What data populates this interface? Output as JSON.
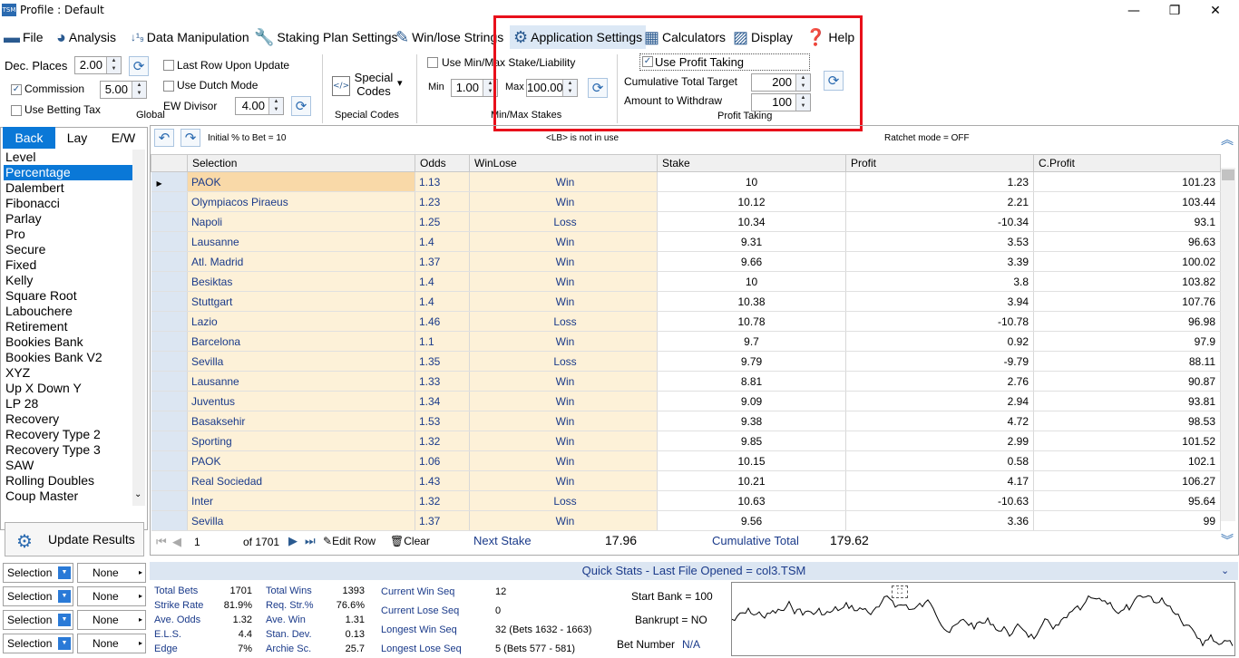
{
  "window": {
    "title": "Profile : Default",
    "app_badge": "TSM"
  },
  "menu": [
    "File",
    "Analysis",
    "Data Manipulation",
    "Staking Plan Settings",
    "Win/lose Strings",
    "Application Settings",
    "Calculators",
    "Display",
    "Help"
  ],
  "global": {
    "dec_places_label": "Dec. Places",
    "dec_places_value": "2.00",
    "commission_label": "Commission",
    "commission_value": "5.00",
    "use_betting_tax": "Use Betting Tax",
    "last_row": "Last Row Upon Update",
    "dutch": "Use Dutch Mode",
    "ew_divisor_label": "EW Divisor",
    "ew_divisor_value": "4.00",
    "group_label": "Global"
  },
  "special": {
    "label": "Special Codes",
    "group": "Special Codes"
  },
  "minmax": {
    "checkbox": "Use Min/Max Stake/Liability",
    "min_label": "Min",
    "min_value": "1.00",
    "max_label": "Max",
    "max_value": "100.00",
    "group": "Min/Max Stakes"
  },
  "profit": {
    "checkbox": "Use Profit Taking",
    "target_label": "Cumulative Total Target",
    "target_value": "200",
    "withdraw_label": "Amount to Withdraw",
    "withdraw_value": "100",
    "group": "Profit Taking"
  },
  "tabs": [
    "Back",
    "Lay",
    "E/W"
  ],
  "strategies": [
    "Level",
    "Percentage",
    "Dalembert",
    "Fibonacci",
    "Parlay",
    "Pro",
    "Secure",
    "Fixed",
    "Kelly",
    "Square Root",
    "Labouchere",
    "Retirement",
    "Bookies Bank",
    "Bookies Bank V2",
    "XYZ",
    "Up X Down Y",
    "LP 28",
    "Recovery",
    "Recovery Type 2",
    "Recovery Type 3",
    "SAW",
    "Rolling Doubles",
    "Coup Master"
  ],
  "selected_strategy": "Percentage",
  "update_button": "Update Results",
  "selectors": [
    {
      "label": "Selection",
      "value": "None"
    },
    {
      "label": "Selection",
      "value": "None"
    },
    {
      "label": "Selection",
      "value": "None"
    },
    {
      "label": "Selection",
      "value": "None"
    }
  ],
  "grid_info": {
    "initial": "Initial % to Bet = 10",
    "lb": "<LB> is not in use",
    "ratchet": "Ratchet mode = OFF"
  },
  "columns": [
    "Selection",
    "Odds",
    "WinLose",
    "Stake",
    "Profit",
    "C.Profit"
  ],
  "rows": [
    [
      "PAOK",
      "1.13",
      "Win",
      "10",
      "1.23",
      "101.23"
    ],
    [
      "Olympiacos Piraeus",
      "1.23",
      "Win",
      "10.12",
      "2.21",
      "103.44"
    ],
    [
      "Napoli",
      "1.25",
      "Loss",
      "10.34",
      "-10.34",
      "93.1"
    ],
    [
      "Lausanne",
      "1.4",
      "Win",
      "9.31",
      "3.53",
      "96.63"
    ],
    [
      "Atl. Madrid",
      "1.37",
      "Win",
      "9.66",
      "3.39",
      "100.02"
    ],
    [
      "Besiktas",
      "1.4",
      "Win",
      "10",
      "3.8",
      "103.82"
    ],
    [
      "Stuttgart",
      "1.4",
      "Win",
      "10.38",
      "3.94",
      "107.76"
    ],
    [
      "Lazio",
      "1.46",
      "Loss",
      "10.78",
      "-10.78",
      "96.98"
    ],
    [
      "Barcelona",
      "1.1",
      "Win",
      "9.7",
      "0.92",
      "97.9"
    ],
    [
      "Sevilla",
      "1.35",
      "Loss",
      "9.79",
      "-9.79",
      "88.11"
    ],
    [
      "Lausanne",
      "1.33",
      "Win",
      "8.81",
      "2.76",
      "90.87"
    ],
    [
      "Juventus",
      "1.34",
      "Win",
      "9.09",
      "2.94",
      "93.81"
    ],
    [
      "Basaksehir",
      "1.53",
      "Win",
      "9.38",
      "4.72",
      "98.53"
    ],
    [
      "Sporting",
      "1.32",
      "Win",
      "9.85",
      "2.99",
      "101.52"
    ],
    [
      "PAOK",
      "1.06",
      "Win",
      "10.15",
      "0.58",
      "102.1"
    ],
    [
      "Real Sociedad",
      "1.43",
      "Win",
      "10.21",
      "4.17",
      "106.27"
    ],
    [
      "Inter",
      "1.32",
      "Loss",
      "10.63",
      "-10.63",
      "95.64"
    ],
    [
      "Sevilla",
      "1.37",
      "Win",
      "9.56",
      "3.36",
      "99"
    ]
  ],
  "nav": {
    "record": "1",
    "of": "of 1701",
    "edit": "Edit Row",
    "clear": "Clear",
    "next_stake_label": "Next Stake",
    "next_stake_value": "17.96",
    "cum_label": "Cumulative Total",
    "cum_value": "179.62"
  },
  "quick_stats": {
    "title": "Quick Stats - Last File Opened = col3.TSM",
    "col1": [
      [
        "Total Bets",
        "1701"
      ],
      [
        "Strike Rate",
        "81.9%"
      ],
      [
        "Ave. Odds",
        "1.32"
      ],
      [
        "E.L.S.",
        "4.4"
      ],
      [
        "Edge",
        "7%"
      ]
    ],
    "col2": [
      [
        "Total Wins",
        "1393"
      ],
      [
        "Req. Str.%",
        "76.6%"
      ],
      [
        "Ave. Win",
        "1.31"
      ],
      [
        "Stan. Dev.",
        "0.13"
      ],
      [
        "Archie Sc.",
        "25.7"
      ]
    ],
    "col3": [
      [
        "Current Win Seq",
        "12"
      ],
      [
        "Current Lose Seq",
        "0"
      ],
      [
        "Longest Win Seq",
        "32  (Bets 1632 - 1663)"
      ],
      [
        "Longest Lose Seq",
        "5  (Bets 577 - 581)"
      ]
    ],
    "start_bank": "Start Bank = 100",
    "bankrupt": "Bankrupt = NO",
    "bet_number_label": "Bet Number",
    "bet_number_value": "N/A"
  },
  "colors": {
    "accent": "#0a78d7",
    "highlight": "#e8101b",
    "row_sel": "#fdf1d8"
  }
}
